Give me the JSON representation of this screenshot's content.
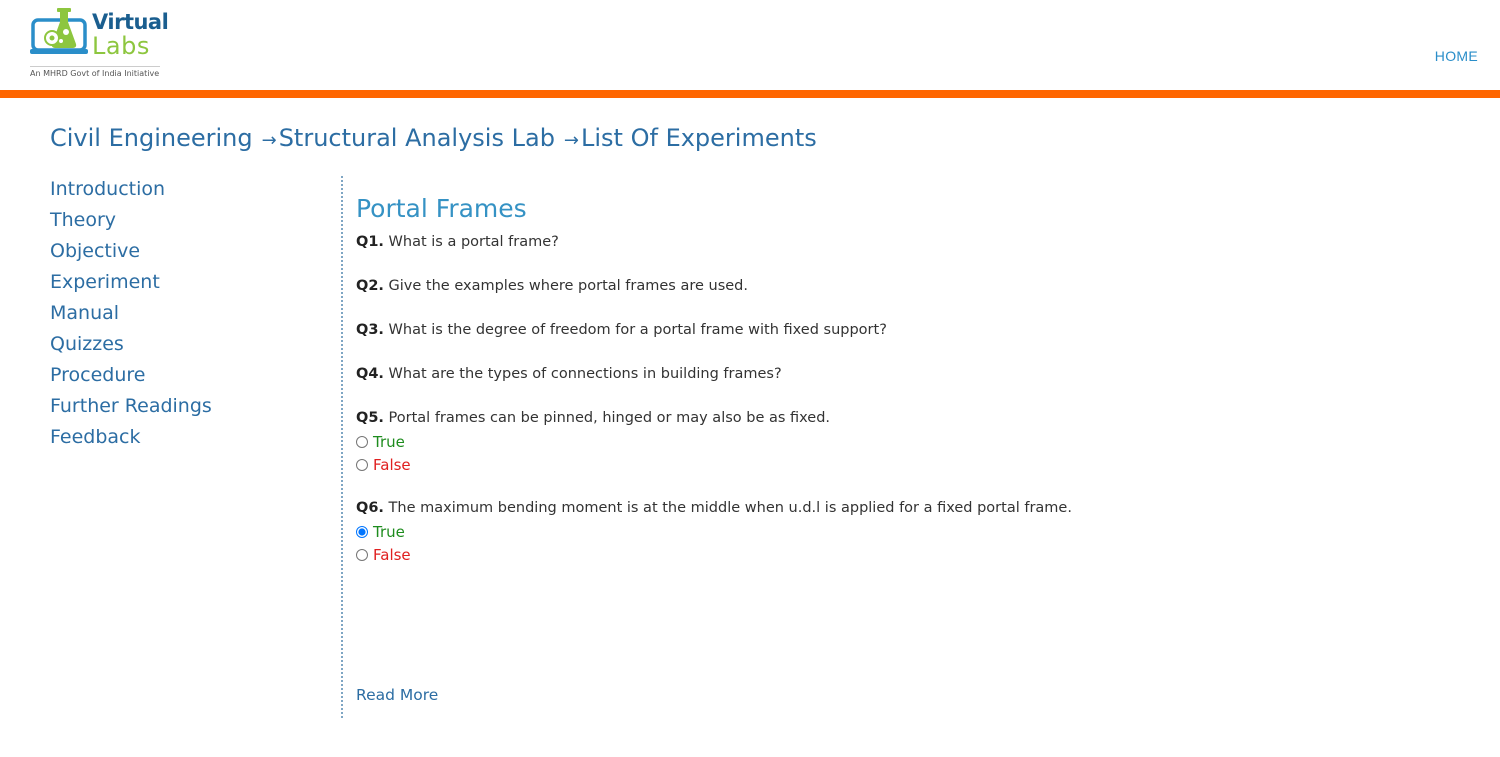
{
  "header": {
    "logo": {
      "word1": "Virtual",
      "word2": "Labs",
      "tagline": "An MHRD Govt of India Initiative"
    },
    "nav": {
      "home_label": "HOME"
    },
    "accent_color": "#ff6600"
  },
  "breadcrumb": {
    "items": [
      "Civil Engineering",
      "Structural Analysis Lab",
      "List Of Experiments"
    ],
    "separator": "→"
  },
  "sidebar": {
    "items": [
      {
        "label": "Introduction"
      },
      {
        "label": "Theory"
      },
      {
        "label": "Objective"
      },
      {
        "label": "Experiment"
      },
      {
        "label": "Manual"
      },
      {
        "label": "Quizzes"
      },
      {
        "label": "Procedure"
      },
      {
        "label": "Further Readings"
      },
      {
        "label": "Feedback"
      }
    ]
  },
  "main": {
    "title": "Portal Frames",
    "questions": [
      {
        "num": "Q1.",
        "text": "What is a portal frame?"
      },
      {
        "num": "Q2.",
        "text": "Give the examples where portal frames are used."
      },
      {
        "num": "Q3.",
        "text": "What is the degree of freedom for a portal frame with fixed support?"
      },
      {
        "num": "Q4.",
        "text": "What are the types of connections in building frames?"
      },
      {
        "num": "Q5.",
        "text": "Portal frames can be pinned, hinged or may also be as fixed.",
        "options": [
          {
            "label": "True",
            "selected": false
          },
          {
            "label": "False",
            "selected": false
          }
        ]
      },
      {
        "num": "Q6.",
        "text": "The maximum bending moment is at the middle when u.d.l is applied for a fixed portal frame.",
        "options": [
          {
            "label": "True",
            "selected": true
          },
          {
            "label": "False",
            "selected": false
          }
        ]
      }
    ],
    "read_more_label": "Read More"
  }
}
